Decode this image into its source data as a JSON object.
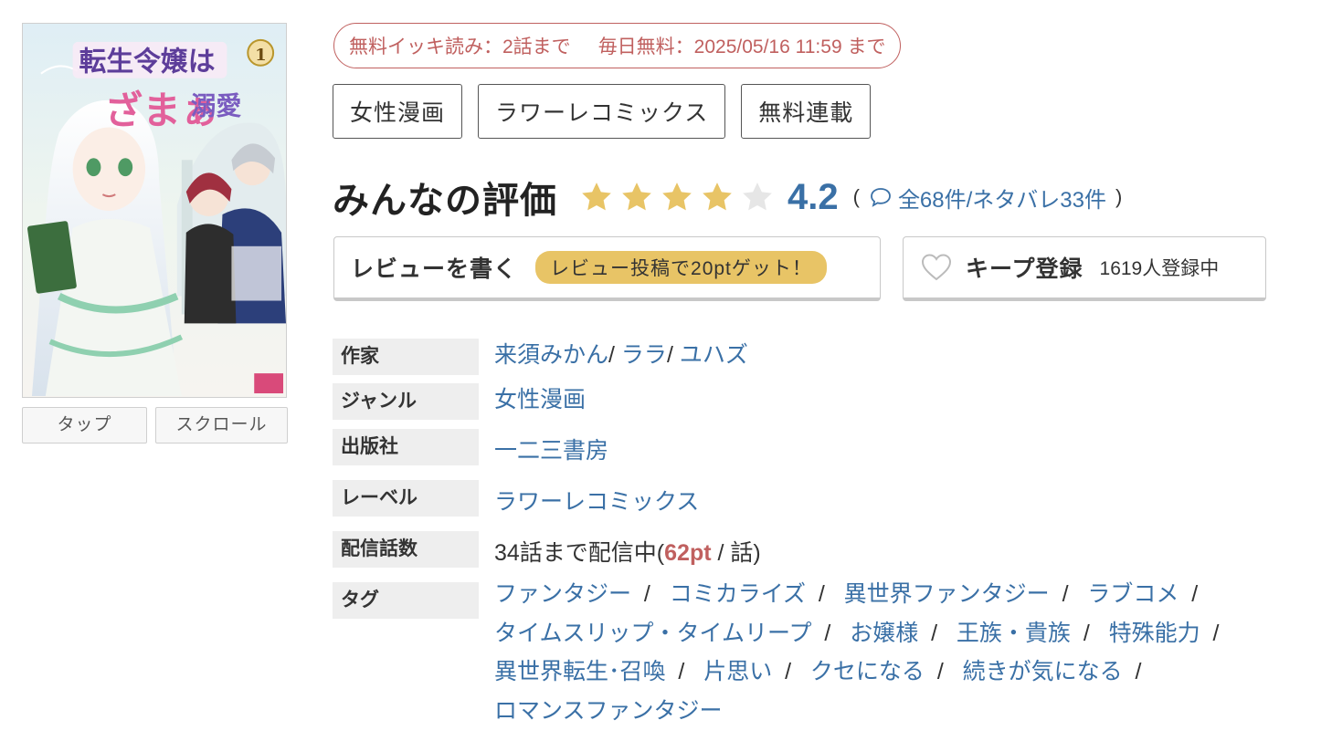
{
  "cover": {
    "tap_button": "タップ",
    "scroll_button": "スクロール"
  },
  "free_info": {
    "ikki": "無料イッキ読み：2話まで",
    "daily": "毎日無料：2025/05/16 11:59 まで"
  },
  "category_tags": [
    "女性漫画",
    "ラワーレコミックス",
    "無料連載"
  ],
  "rating": {
    "title": "みんなの評価",
    "score": "4.2",
    "score_value": 4.2,
    "open_paren": "(",
    "close_paren": ")",
    "reviews_link": "全68件/ネタバレ33件",
    "star_color": "#e8c466",
    "star_empty_color": "#e6e6e6"
  },
  "review": {
    "label": "レビューを書く",
    "badge": "レビュー投稿で20ptゲット！"
  },
  "keep": {
    "label": "キープ登録",
    "count": "1619人登録中"
  },
  "details": {
    "author_label": "作家",
    "authors": [
      "来須みかん",
      "ララ",
      "ユハズ"
    ],
    "genre_label": "ジャンル",
    "genre": "女性漫画",
    "publisher_label": "出版社",
    "publisher": "一二三書房",
    "label_label": "レーベル",
    "label_value": "ラワーレコミックス",
    "episodes_label": "配信話数",
    "episodes_prefix": "34話まで配信中(",
    "episodes_price": "62pt",
    "episodes_suffix": " / 話)",
    "tags_label": "タグ",
    "tags": [
      "ファンタジー",
      "コミカライズ",
      "異世界ファンタジー",
      "ラブコメ",
      "タイムスリップ・タイムリープ",
      "お嬢様",
      "王族・貴族",
      "特殊能力",
      "異世界転生･召喚",
      "片思い",
      "クセになる",
      "続きが気になる",
      "ロマンスファンタジー"
    ]
  },
  "colors": {
    "link": "#3a70a6",
    "accent_red": "#c0605f",
    "badge_yellow": "#e8c466"
  }
}
